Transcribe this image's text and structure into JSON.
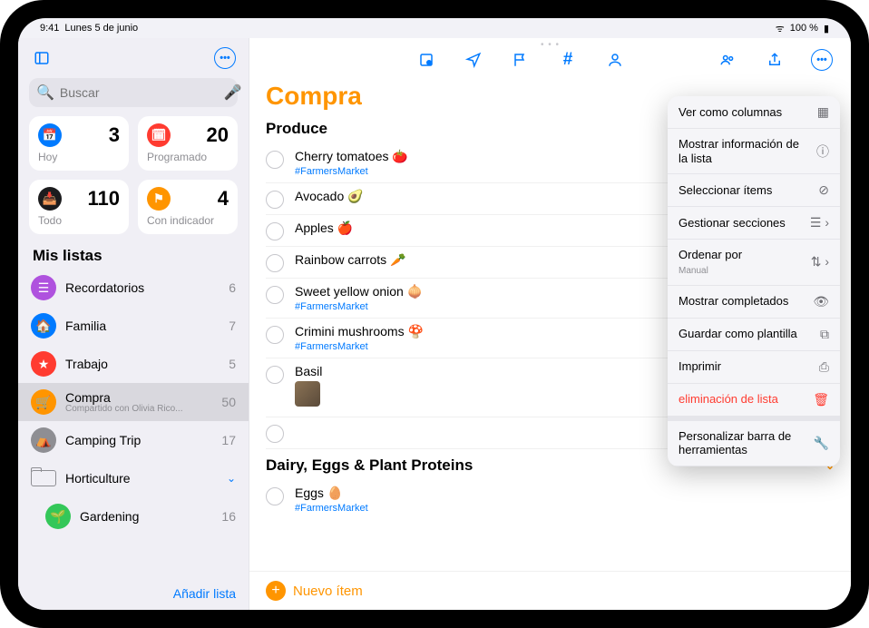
{
  "status": {
    "time": "9:41",
    "date": "Lunes 5 de junio",
    "battery": "100 %"
  },
  "search": {
    "placeholder": "Buscar"
  },
  "smart": {
    "today": {
      "label": "Hoy",
      "count": 3,
      "color": "#007aff"
    },
    "scheduled": {
      "label": "Programado",
      "count": 20,
      "color": "#ff3b30"
    },
    "all": {
      "label": "Todo",
      "count": 110,
      "color": "#1c1c1e"
    },
    "flagged": {
      "label": "Con indicador",
      "count": 4,
      "color": "#ff9500"
    }
  },
  "my_lists_header": "Mis listas",
  "lists": {
    "reminders": {
      "name": "Recordatorios",
      "count": 6,
      "color": "#af52de"
    },
    "family": {
      "name": "Familia",
      "count": 7,
      "color": "#007aff"
    },
    "work": {
      "name": "Trabajo",
      "count": 5,
      "color": "#ff3b30"
    },
    "shopping": {
      "name": "Compra",
      "sub": "Compartido con Olivia Rico...",
      "count": 50,
      "color": "#ff9500"
    },
    "camping": {
      "name": "Camping Trip",
      "count": 17,
      "color": "#8e8e93"
    },
    "horticulture": {
      "name": "Horticulture"
    },
    "gardening": {
      "name": "Gardening",
      "count": 16,
      "color": "#34c759"
    }
  },
  "add_list_label": "Añadir lista",
  "main": {
    "title": "Compra",
    "new_item_label": "Nuevo ítem",
    "tag": "#FarmersMarket",
    "sections": {
      "produce": {
        "header": "Produce",
        "items": {
          "cherry": {
            "title": "Cherry tomatoes 🍅",
            "tag": true
          },
          "avocado": {
            "title": "Avocado 🥑"
          },
          "apples": {
            "title": "Apples 🍎"
          },
          "carrots": {
            "title": "Rainbow carrots 🥕"
          },
          "onion": {
            "title": "Sweet yellow onion 🧅",
            "tag": true
          },
          "mushroom": {
            "title": "Crimini mushrooms 🍄",
            "tag": true
          },
          "basil": {
            "title": "Basil",
            "thumb": true
          }
        }
      },
      "dairy": {
        "header": "Dairy, Eggs & Plant Proteins",
        "items": {
          "eggs": {
            "title": "Eggs 🥚",
            "tag": true
          }
        }
      }
    }
  },
  "popover": {
    "columns": "Ver como columnas",
    "info": "Mostrar información de la lista",
    "select": "Seleccionar ítems",
    "sections": "Gestionar secciones",
    "sort": "Ordenar por",
    "sort_sub": "Manual",
    "completed": "Mostrar completados",
    "template": "Guardar como plantilla",
    "print": "Imprimir",
    "delete": "eliminación de lista",
    "customize": "Personalizar barra de herramientas"
  }
}
